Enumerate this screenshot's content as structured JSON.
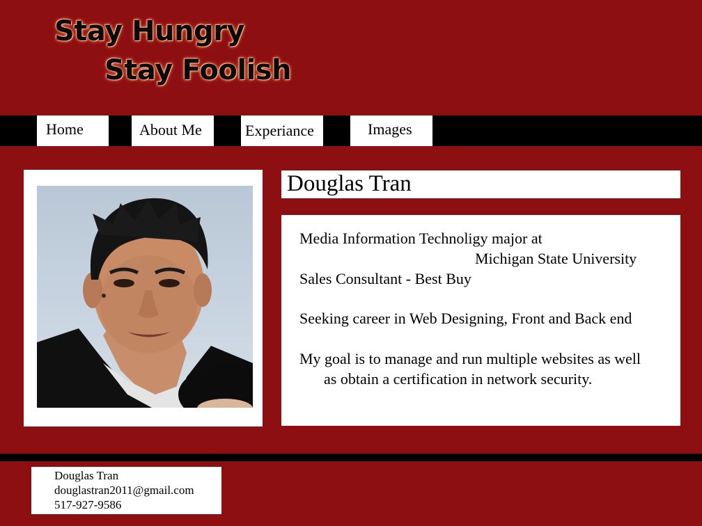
{
  "header": {
    "logo_line1": "Stay Hungry",
    "logo_line2": "Stay Foolish"
  },
  "nav": {
    "items": [
      {
        "label": "Home"
      },
      {
        "label": "About Me"
      },
      {
        "label": "Experiance"
      },
      {
        "label": "Images"
      }
    ]
  },
  "profile": {
    "name": "Douglas Tran",
    "bio": {
      "line1": "Media Information Technoligy major at",
      "line2": "Michigan State University",
      "line3": "Sales Consultant - Best Buy",
      "line4": "Seeking career in Web Designing, Front and Back end",
      "line5": "My goal is to manage and run multiple websites as well",
      "line6": "as obtain a certification in network security."
    }
  },
  "footer": {
    "contact_name": "Douglas Tran",
    "contact_email": "douglastran2011@gmail.com",
    "contact_phone": "517-927-9586"
  },
  "colors": {
    "background": "#8e0f12",
    "nav_bar": "#000000",
    "panel": "#ffffff"
  }
}
